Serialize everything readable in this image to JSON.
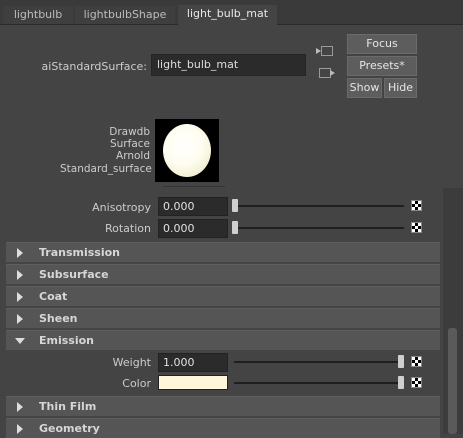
{
  "tabs": [
    {
      "label": "lightbulb"
    },
    {
      "label": "lightbulbShape"
    },
    {
      "label": "light_bulb_mat"
    }
  ],
  "header": {
    "node_type_label": "aiStandardSurface:",
    "node_name": "light_bulb_mat",
    "focus_label": "Focus",
    "presets_label": "Presets*",
    "show_label": "Show",
    "hide_label": "Hide"
  },
  "swatch": {
    "renderers": [
      "Drawdb",
      "Surface",
      "Arnold",
      "Standard_surface"
    ]
  },
  "attributes": {
    "anisotropy": {
      "label": "Anisotropy",
      "value": "0.000"
    },
    "rotation": {
      "label": "Rotation",
      "value": "0.000"
    }
  },
  "sections": [
    {
      "title": "Transmission",
      "expanded": false
    },
    {
      "title": "Subsurface",
      "expanded": false
    },
    {
      "title": "Coat",
      "expanded": false
    },
    {
      "title": "Sheen",
      "expanded": false
    },
    {
      "title": "Emission",
      "expanded": true
    },
    {
      "title": "Thin Film",
      "expanded": false
    },
    {
      "title": "Geometry",
      "expanded": false
    }
  ],
  "emission": {
    "weight": {
      "label": "Weight",
      "value": "1.000",
      "slider_fraction": 1.0
    },
    "color": {
      "label": "Color",
      "hex": "#fff6dc",
      "slider_fraction": 1.0
    }
  }
}
